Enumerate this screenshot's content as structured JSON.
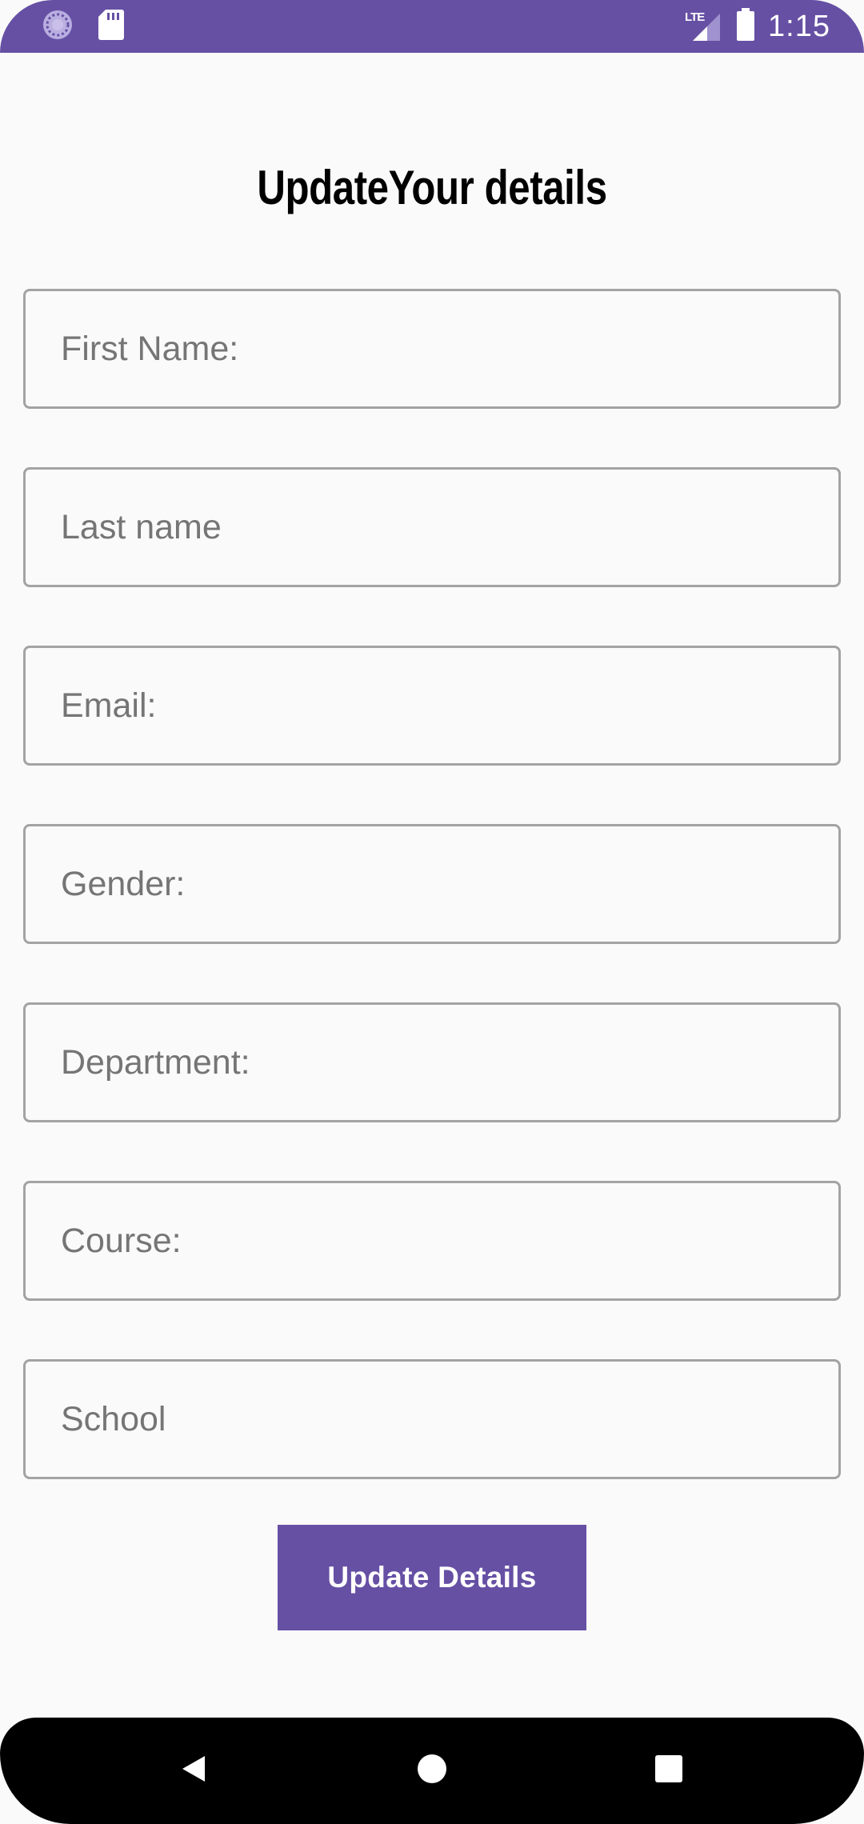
{
  "status_bar": {
    "time": "1:15",
    "network_label": "LTE",
    "icons": [
      "sync-icon",
      "sd-card-icon",
      "signal-icon",
      "battery-icon"
    ],
    "background_color": "#6650a4"
  },
  "page": {
    "title": "UpdateYour details"
  },
  "form": {
    "fields": [
      {
        "name": "first-name-field",
        "placeholder": "First Name:",
        "value": ""
      },
      {
        "name": "last-name-field",
        "placeholder": "Last name",
        "value": ""
      },
      {
        "name": "email-field",
        "placeholder": "Email:",
        "value": ""
      },
      {
        "name": "gender-field",
        "placeholder": "Gender:",
        "value": ""
      },
      {
        "name": "department-field",
        "placeholder": "Department:",
        "value": ""
      },
      {
        "name": "course-field",
        "placeholder": "Course:",
        "value": ""
      },
      {
        "name": "school-field",
        "placeholder": "School",
        "value": ""
      }
    ],
    "submit_label": "Update Details",
    "accent_color": "#6650a4"
  },
  "nav_bar": {
    "icons": [
      "back-icon",
      "home-icon",
      "recents-icon"
    ]
  }
}
